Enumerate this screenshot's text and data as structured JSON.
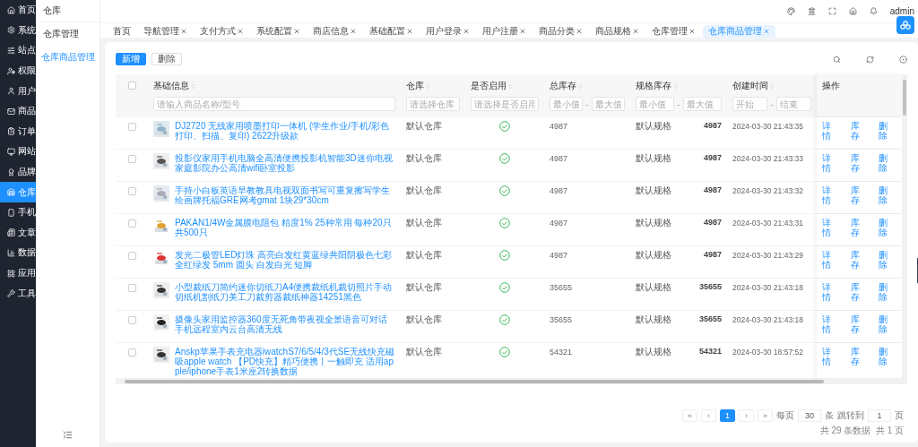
{
  "sidebar": {
    "items": [
      {
        "label": "首页",
        "selected": false
      },
      {
        "label": "系统",
        "selected": false
      },
      {
        "label": "站点",
        "selected": false
      },
      {
        "label": "权限",
        "selected": false
      },
      {
        "label": "用户",
        "selected": false
      },
      {
        "label": "商品",
        "selected": false
      },
      {
        "label": "订单",
        "selected": false
      },
      {
        "label": "网站",
        "selected": false
      },
      {
        "label": "品牌",
        "selected": false
      },
      {
        "label": "仓库",
        "selected": true
      },
      {
        "label": "手机",
        "selected": false
      },
      {
        "label": "文章",
        "selected": false
      },
      {
        "label": "数据",
        "selected": false
      },
      {
        "label": "应用",
        "selected": false
      },
      {
        "label": "工具",
        "selected": false
      }
    ]
  },
  "submenu": {
    "title": "仓库",
    "groups": [
      {
        "label": "仓库管理",
        "items": [
          {
            "label": "仓库商品管理",
            "selected": true
          }
        ]
      }
    ]
  },
  "header": {
    "user": "admin"
  },
  "tabs": [
    {
      "label": "首页",
      "closable": false,
      "selected": false
    },
    {
      "label": "导航管理",
      "closable": true,
      "selected": false
    },
    {
      "label": "支付方式",
      "closable": true,
      "selected": false
    },
    {
      "label": "系统配置",
      "closable": true,
      "selected": false
    },
    {
      "label": "商店信息",
      "closable": true,
      "selected": false
    },
    {
      "label": "基础配置",
      "closable": true,
      "selected": false
    },
    {
      "label": "用户登录",
      "closable": true,
      "selected": false
    },
    {
      "label": "用户注册",
      "closable": true,
      "selected": false
    },
    {
      "label": "商品分类",
      "closable": true,
      "selected": false
    },
    {
      "label": "商品规格",
      "closable": true,
      "selected": false
    },
    {
      "label": "仓库管理",
      "closable": true,
      "selected": false
    },
    {
      "label": "仓库商品管理",
      "closable": true,
      "selected": true
    }
  ],
  "toolbar": {
    "buttons": [
      {
        "label": "新增",
        "kind": "primary"
      },
      {
        "label": "删除",
        "kind": "default"
      }
    ]
  },
  "table": {
    "all_checked": false,
    "columns": [
      {
        "label": "基础信息",
        "filters": [
          {
            "placeholder": "请输入商品名称/型号"
          }
        ]
      },
      {
        "label": "仓库",
        "filters": [
          {
            "placeholder": "请选择仓库"
          }
        ]
      },
      {
        "label": "是否启用",
        "filters": [
          {
            "placeholder": "请选择是否启用"
          }
        ]
      },
      {
        "label": "总库存",
        "filters": [
          {
            "placeholder": "最小值"
          },
          {
            "placeholder": "最大值"
          }
        ],
        "separator": "-"
      },
      {
        "label": "规格库存",
        "filters": [
          {
            "placeholder": "最小值"
          },
          {
            "placeholder": "最大值"
          }
        ],
        "separator": "-"
      },
      {
        "label": "创建时间",
        "filters": [
          {
            "placeholder": "开始"
          },
          {
            "placeholder": "结束"
          }
        ],
        "separator": "-"
      },
      {
        "label": "操作"
      }
    ],
    "rows": [
      {
        "checked": false,
        "name": "DJ2720 无线家用喷墨打印一体机 (学生作业/手机/彩色打印、扫描、复印) 2622升级款",
        "warehouse": "默认仓库",
        "enabled": true,
        "total_stock": "4987",
        "spec": "默认规格",
        "spec_stock": "4987",
        "created": "2024-03-30 21:43:35",
        "actions": [
          "详情",
          "库存",
          "删除"
        ]
      },
      {
        "checked": false,
        "name": "投影仪家用手机电脑全高清便携投影机智能3D迷你电视家庭影院办公高清wifi卧室投影",
        "warehouse": "默认仓库",
        "enabled": true,
        "total_stock": "4987",
        "spec": "默认规格",
        "spec_stock": "4987",
        "created": "2024-03-30 21:43:33",
        "actions": [
          "详情",
          "库存",
          "删除"
        ]
      },
      {
        "checked": false,
        "name": "手持小白板英语早教教具电视双面书写可重复擦写学生绘画牌托福GRE网考gmat 1块29*30cm",
        "warehouse": "默认仓库",
        "enabled": true,
        "total_stock": "4987",
        "spec": "默认规格",
        "spec_stock": "4987",
        "created": "2024-03-30 21:43:32",
        "actions": [
          "详情",
          "库存",
          "删除"
        ]
      },
      {
        "checked": false,
        "name": "PAKAN1/4W金属膜电阻包 精度1% 25种常用 每种20只共500只",
        "warehouse": "默认仓库",
        "enabled": true,
        "total_stock": "4987",
        "spec": "默认规格",
        "spec_stock": "4987",
        "created": "2024-03-30 21:43:31",
        "actions": [
          "详情",
          "库存",
          "删除"
        ]
      },
      {
        "checked": false,
        "name": "发光二极管LED灯珠 高亮白发红黄蓝绿共阳阴极色七彩全红绿发 5mm 圆头 白发白光 短脚",
        "warehouse": "默认仓库",
        "enabled": true,
        "total_stock": "4987",
        "spec": "默认规格",
        "spec_stock": "4987",
        "created": "2024-03-30 21:43:29",
        "actions": [
          "详情",
          "库存",
          "删除"
        ]
      },
      {
        "checked": false,
        "name": "小型裁纸刀简约迷你切纸刀A4便携裁纸机裁切照片手动切纸机割纸刀美工刀裁剪器裁纸神器14251黑色",
        "warehouse": "默认仓库",
        "enabled": true,
        "total_stock": "35655",
        "spec": "默认规格",
        "spec_stock": "35655",
        "created": "2024-03-30 21:43:18",
        "actions": [
          "详情",
          "库存",
          "删除"
        ]
      },
      {
        "checked": false,
        "name": "摄像头家用监控器360度无死角带夜视全景语音可对话手机远程室内云台高清无线",
        "warehouse": "默认仓库",
        "enabled": true,
        "total_stock": "35655",
        "spec": "默认规格",
        "spec_stock": "35655",
        "created": "2024-03-30 21:43:18",
        "actions": [
          "详情",
          "库存",
          "删除"
        ]
      },
      {
        "checked": false,
        "name": "Anskp苹果手表充电器iwatchS7/6/5/4/3代SE无线快充磁吸apple watch 【PD快充】精巧便携丨一触即充 适用apple/iphone手表1米座2转换数据",
        "warehouse": "默认仓库",
        "enabled": true,
        "total_stock": "54321",
        "spec": "默认规格",
        "spec_stock": "54321",
        "created": "2024-03-30 18:57:52",
        "actions": [
          "详情",
          "库存",
          "删除"
        ]
      }
    ]
  },
  "pagination": {
    "first": "«",
    "prev": "‹",
    "pages": [
      {
        "label": "1",
        "selected": true
      }
    ],
    "next": "›",
    "last": "»",
    "per_page_label": "每页",
    "per_page": "30",
    "per_page_unit": "条",
    "jump_label": "跳转到",
    "jump_page": "1",
    "jump_unit": "页",
    "summary": "共 29 条数据  共 1 页"
  }
}
